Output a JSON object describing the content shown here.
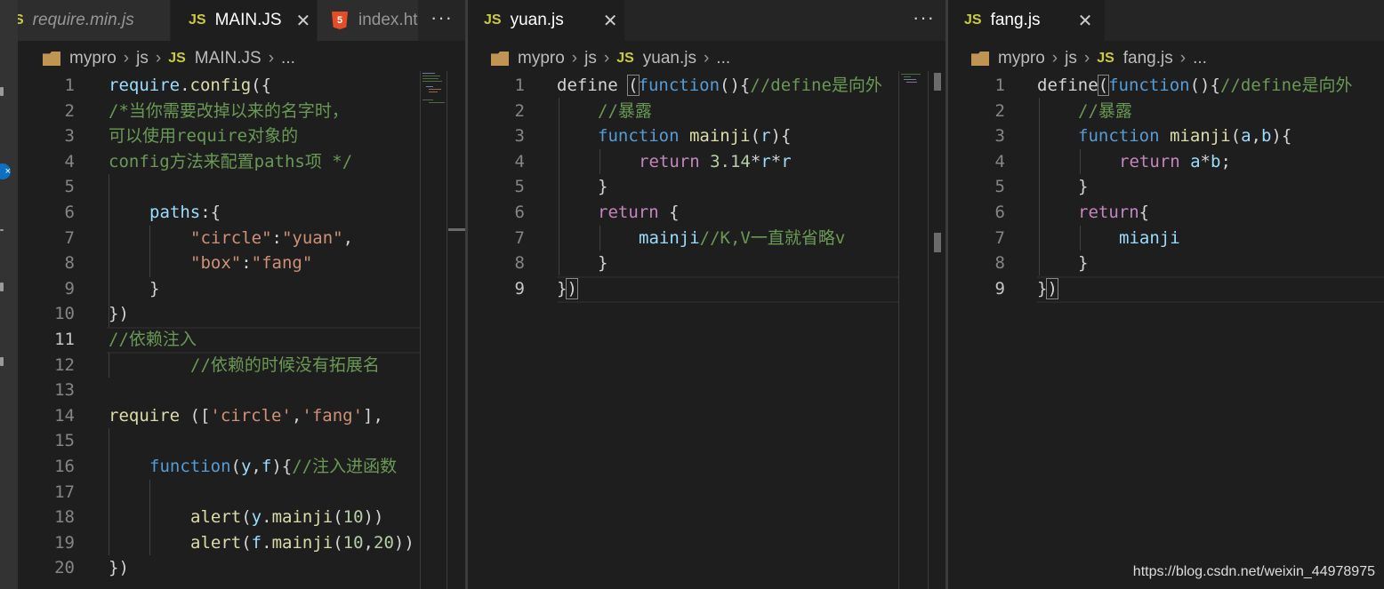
{
  "pane1": {
    "tabs": [
      {
        "label": "require.min.js",
        "kind": "js"
      },
      {
        "label": "MAIN.JS",
        "kind": "js"
      },
      {
        "label": "index.ht",
        "kind": "html"
      }
    ],
    "more": "···",
    "breadcrumb": [
      "mypro",
      "js",
      "MAIN.JS",
      "..."
    ],
    "lines": [
      {
        "n": "1",
        "t": "require.config({"
      },
      {
        "n": "2",
        "t": "/*当你需要改掉以来的名字时，"
      },
      {
        "n": "3",
        "t": "可以使用require对象的"
      },
      {
        "n": "4",
        "t": "config方法来配置paths项 */"
      },
      {
        "n": "5",
        "t": ""
      },
      {
        "n": "6",
        "t": "paths:{"
      },
      {
        "n": "7",
        "t": "\"circle\":\"yuan\","
      },
      {
        "n": "8",
        "t": "\"box\":\"fang\""
      },
      {
        "n": "9",
        "t": "}"
      },
      {
        "n": "10",
        "t": "})"
      },
      {
        "n": "11",
        "t": "//依赖注入"
      },
      {
        "n": "12",
        "t": "//依赖的时候没有拓展名"
      },
      {
        "n": "13",
        "t": ""
      },
      {
        "n": "14",
        "t": "require (['circle','fang'],"
      },
      {
        "n": "15",
        "t": ""
      },
      {
        "n": "16",
        "t": "function(y,f){//注入进函数"
      },
      {
        "n": "17",
        "t": ""
      },
      {
        "n": "18",
        "t": "alert(y.mainji(10))"
      },
      {
        "n": "19",
        "t": "alert(f.mainji(10,20))"
      },
      {
        "n": "20",
        "t": "})"
      }
    ]
  },
  "pane2": {
    "tab": {
      "label": "yuan.js",
      "close": "✕"
    },
    "more": "···",
    "breadcrumb": [
      "mypro",
      "js",
      "yuan.js",
      "..."
    ],
    "lines": [
      {
        "n": "1",
        "t": "define (function(){//define是向外"
      },
      {
        "n": "2",
        "t": "//暴露"
      },
      {
        "n": "3",
        "t": "function mainji(r){"
      },
      {
        "n": "4",
        "t": "return 3.14*r*r"
      },
      {
        "n": "5",
        "t": "}"
      },
      {
        "n": "6",
        "t": "return {"
      },
      {
        "n": "7",
        "t": "mainji//K,V一直就省略v"
      },
      {
        "n": "8",
        "t": "}"
      },
      {
        "n": "9",
        "t": "})"
      }
    ]
  },
  "pane3": {
    "tab": {
      "label": "fang.js",
      "close": "✕"
    },
    "breadcrumb": [
      "mypro",
      "js",
      "fang.js",
      "..."
    ],
    "lines": [
      {
        "n": "1",
        "t": "define(function(){//define是向外"
      },
      {
        "n": "2",
        "t": "//暴露"
      },
      {
        "n": "3",
        "t": "function mianji(a,b){"
      },
      {
        "n": "4",
        "t": "return a*b;"
      },
      {
        "n": "5",
        "t": "}"
      },
      {
        "n": "6",
        "t": "return{"
      },
      {
        "n": "7",
        "t": "mianji"
      },
      {
        "n": "8",
        "t": "}"
      },
      {
        "n": "9",
        "t": "})"
      }
    ]
  },
  "watermark": "https://blog.csdn.net/weixin_44978975",
  "colors": {
    "keyword": "#569cd6",
    "function": "#dcdcaa",
    "comment": "#6a9955",
    "string": "#ce9178",
    "variable": "#9cdcfe",
    "number": "#b5cea8",
    "control": "#c586c0"
  }
}
